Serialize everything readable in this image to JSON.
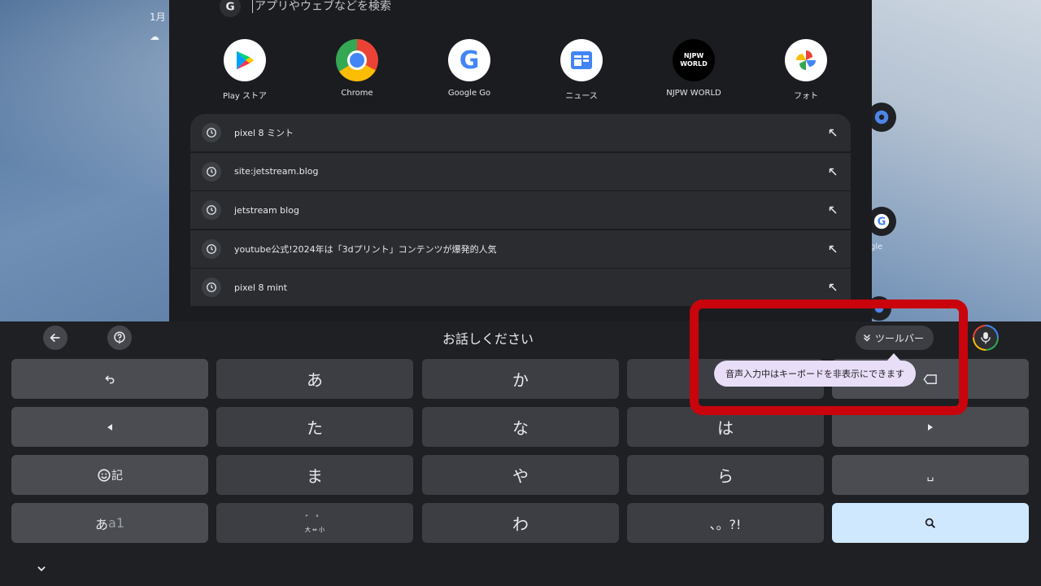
{
  "desktop": {
    "date_fragment": "1月",
    "shelf_label": "gle"
  },
  "launcher": {
    "search_placeholder": "アプリやウェブなどを検索",
    "apps": [
      {
        "label": "Play ストア",
        "icon": "play-store-icon"
      },
      {
        "label": "Chrome",
        "icon": "chrome-icon"
      },
      {
        "label": "Google Go",
        "icon": "google-go-icon"
      },
      {
        "label": "ニュース",
        "icon": "google-news-icon"
      },
      {
        "label": "NJPW WORLD",
        "icon": "njpw-world-icon"
      },
      {
        "label": "フォト",
        "icon": "google-photos-icon"
      }
    ],
    "recent_searches": [
      "pixel 8 ミント",
      "site:jetstream.blog",
      "jetstream blog",
      "youtube公式!2024年は「3dプリント」コンテンツが爆発的人気",
      "pixel 8 mint"
    ]
  },
  "keyboard": {
    "voice_status": "お話しください",
    "toolbar_label": "ツールバー",
    "tooltip": "音声入力中はキーボードを非表示にできます",
    "keys": {
      "a": "あ",
      "ka": "か",
      "ta": "た",
      "na": "な",
      "ha": "は",
      "ma": "ま",
      "ya": "や",
      "ra": "ら",
      "wa": "わ",
      "punct": "、。?!",
      "emoji_kigou_suffix": "記",
      "mode_kana": "あ",
      "mode_alpha": "a1",
      "dakuten_top": "゛ ゜",
      "dakuten_bottom": "大 ⇔ 小",
      "space": "␣"
    }
  },
  "colors": {
    "highlight_red": "#c9040c",
    "enter_key_bg": "#cfe8fd",
    "tooltip_bg": "#e8def8"
  }
}
